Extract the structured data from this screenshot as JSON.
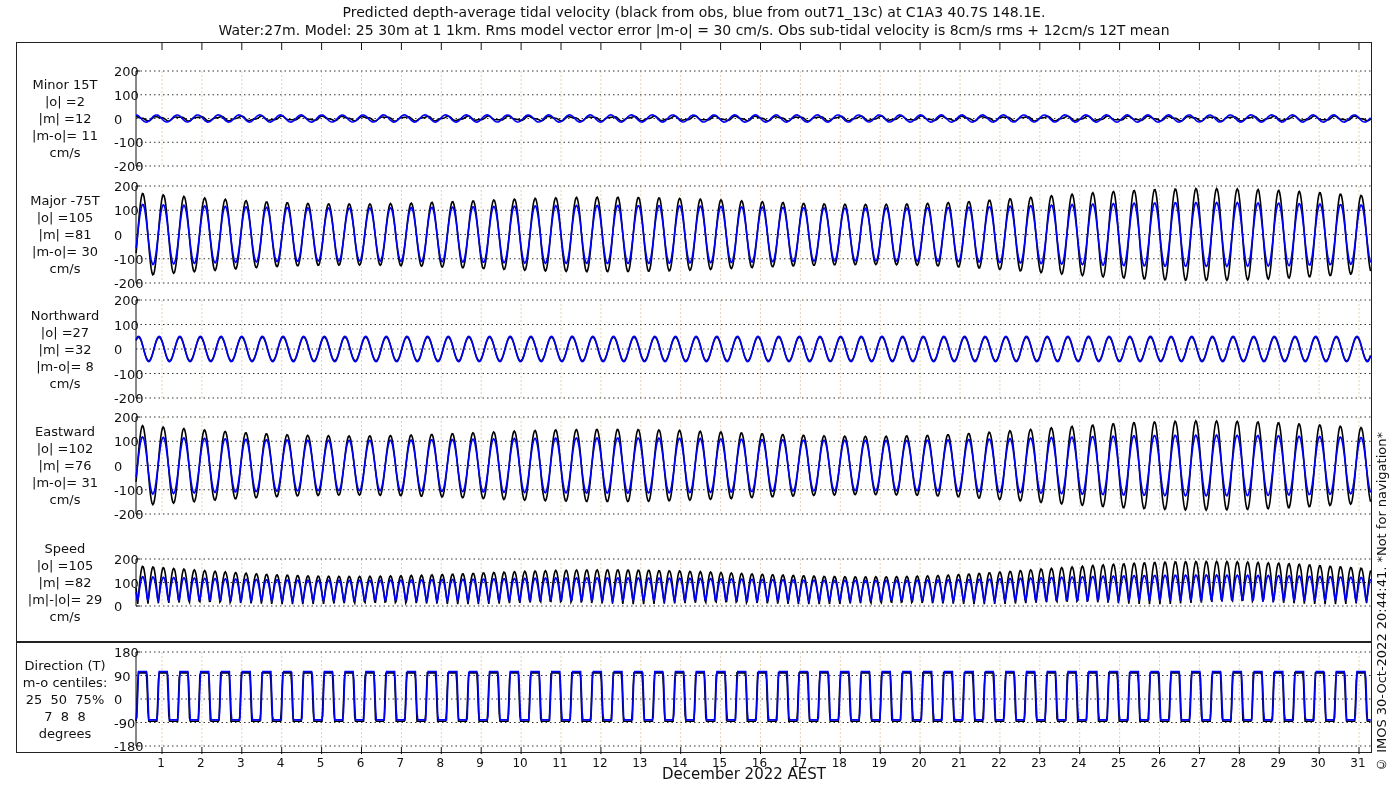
{
  "title": [
    "Predicted depth-average tidal velocity (black from obs, blue from out71_13c) at C1A3 40.7S 148.1E.",
    "Water:27m. Model: 25 30m at 1 1km. Rms model vector error |m-o| = 30 cm/s. Obs sub-tidal velocity is 8cm/s rms + 12cm/s 12T mean"
  ],
  "panels": [
    {
      "kind": "minor",
      "label": [
        "Minor 15T",
        "|o| =2",
        "|m| =12",
        "|m-o|= 11",
        "cm/s"
      ],
      "yticks": [
        "200",
        "100",
        "0",
        "-100",
        "-200"
      ]
    },
    {
      "kind": "major",
      "label": [
        "Major -75T",
        "|o| =105",
        "|m| =81",
        "|m-o|= 30",
        "cm/s"
      ],
      "yticks": [
        "200",
        "100",
        "0",
        "-100",
        "-200"
      ]
    },
    {
      "kind": "north",
      "label": [
        "Northward",
        "|o| =27",
        "|m| =32",
        "|m-o|= 8",
        "cm/s"
      ],
      "yticks": [
        "200",
        "100",
        "0",
        "-100",
        "-200"
      ]
    },
    {
      "kind": "east",
      "label": [
        "Eastward",
        "|o| =102",
        "|m| =76",
        "|m-o|= 31",
        "cm/s"
      ],
      "yticks": [
        "200",
        "100",
        "0",
        "-100",
        "-200"
      ]
    },
    {
      "kind": "speed",
      "label": [
        "Speed",
        "|o| =105",
        "|m| =82",
        "|m|-|o|= 29",
        "cm/s"
      ],
      "yticks": [
        "200",
        "100",
        "0"
      ]
    },
    {
      "kind": "direction",
      "label": [
        "Direction (T)",
        "m-o centiles:",
        "25  50  75%",
        "7  8  8",
        "degrees"
      ],
      "yticks": [
        "180",
        "90",
        "0",
        "-90",
        "-180"
      ]
    }
  ],
  "xticks": [
    "1",
    "2",
    "3",
    "4",
    "5",
    "6",
    "7",
    "8",
    "9",
    "10",
    "11",
    "12",
    "13",
    "14",
    "15",
    "16",
    "17",
    "18",
    "19",
    "20",
    "21",
    "22",
    "23",
    "24",
    "25",
    "26",
    "27",
    "28",
    "29",
    "30",
    "31"
  ],
  "xlabel": "December 2022 AEST",
  "side_note": "© IMOS 30-Oct-2022 20:44:41. *Not for navigation*"
}
